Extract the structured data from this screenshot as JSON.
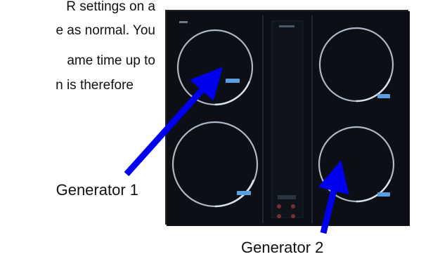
{
  "body_text": {
    "line1": "R settings on a",
    "line2": "e as normal. You",
    "line3": "ame time up to",
    "line4": "n is therefore"
  },
  "callouts": {
    "generator1": "Generator 1",
    "generator2": "Generator 2"
  },
  "colors": {
    "arrow": "#0000ee",
    "panel_bg": "#0d1117",
    "ring": "#aab6c8",
    "accent": "#5aa0e0"
  },
  "icons": {
    "knob": "circular-dial-icon",
    "arrow": "blue-arrow-icon"
  }
}
